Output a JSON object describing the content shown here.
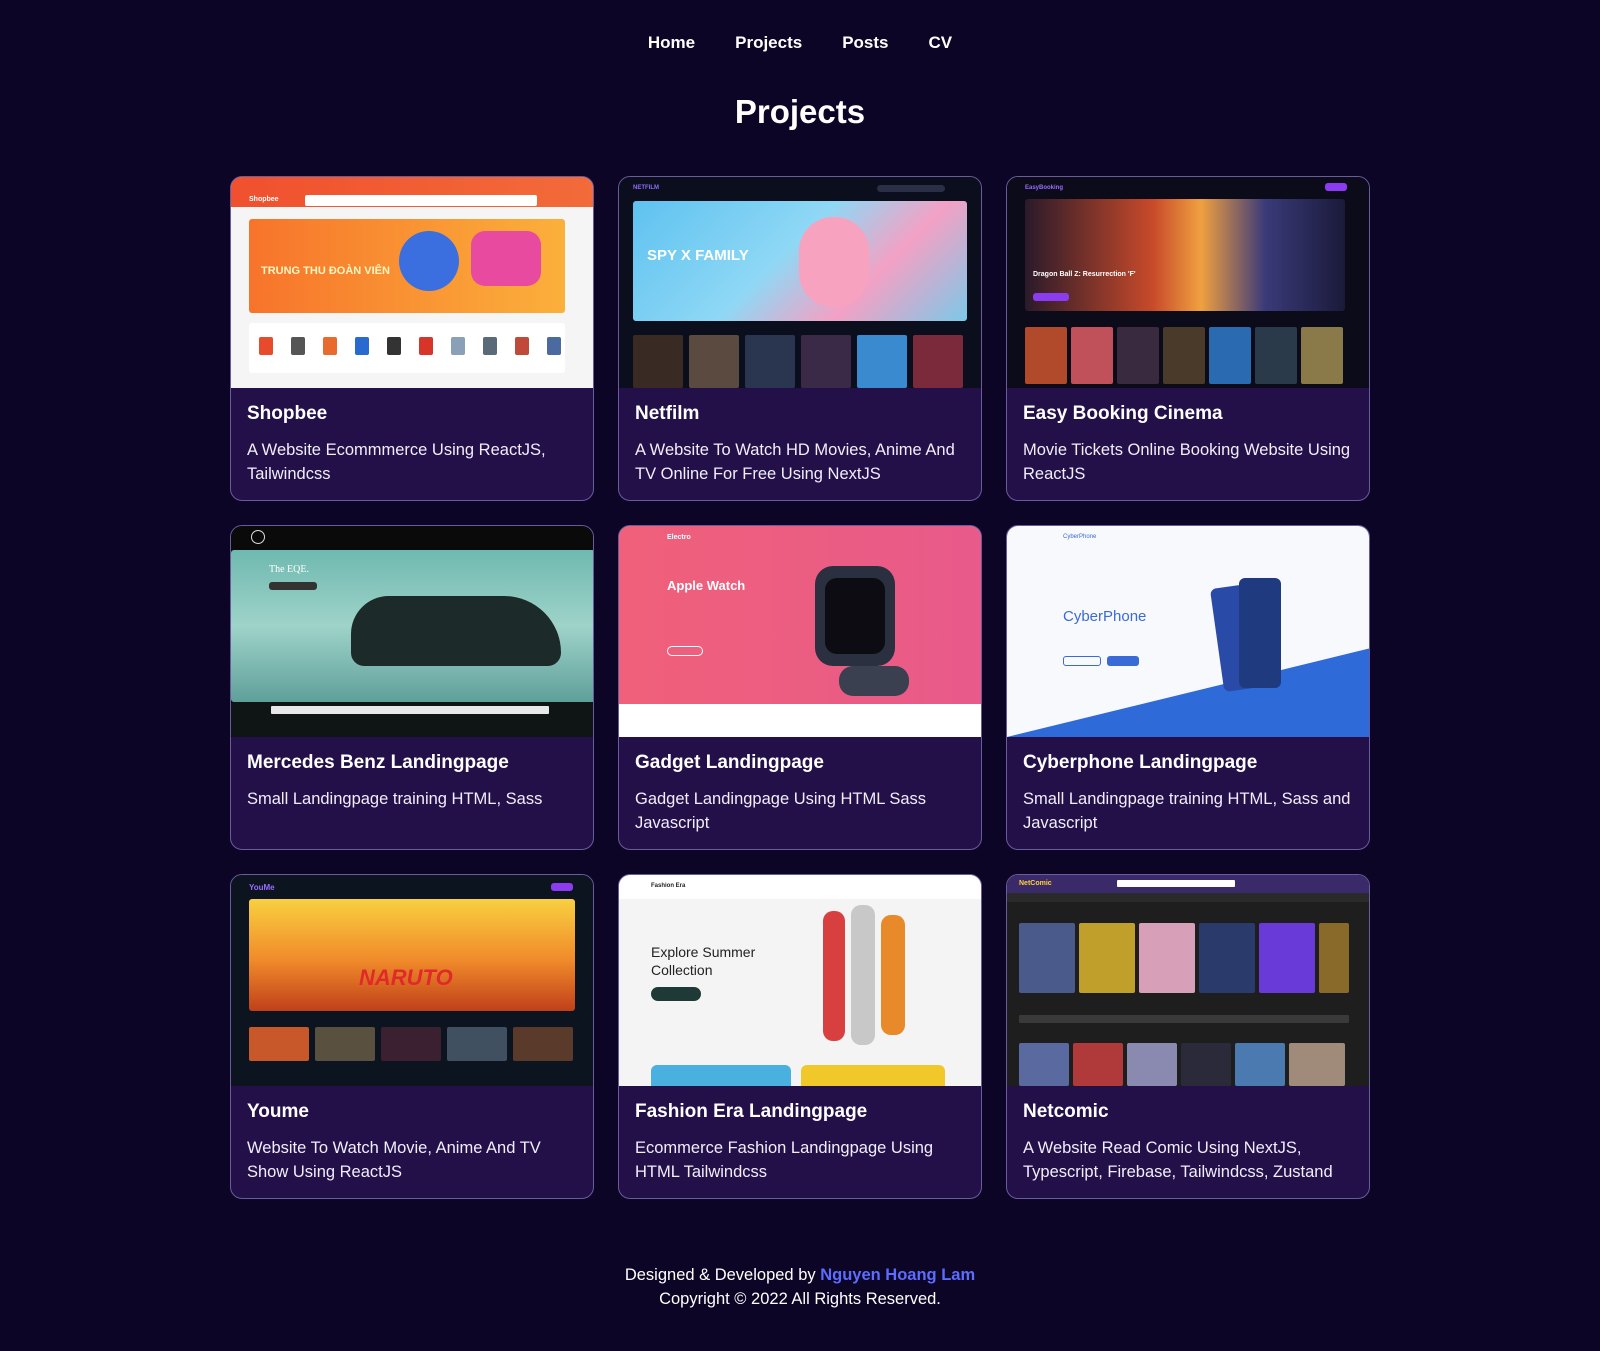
{
  "nav": {
    "items": [
      {
        "label": "Home"
      },
      {
        "label": "Projects"
      },
      {
        "label": "Posts"
      },
      {
        "label": "CV"
      }
    ]
  },
  "page": {
    "title": "Projects"
  },
  "projects": [
    {
      "title": "Shopbee",
      "description": "A Website Ecommmerce Using ReactJS, Tailwindcss",
      "thumb_brand": "Shopbee",
      "thumb_text": "TRUNG THU ĐOÀN VIÊN"
    },
    {
      "title": "Netfilm",
      "description": "A Website To Watch HD Movies, Anime And TV Online For Free Using NextJS",
      "thumb_brand": "NETFILM",
      "thumb_text": "SPY X FAMILY"
    },
    {
      "title": "Easy Booking Cinema",
      "description": "Movie Tickets Online Booking Website Using ReactJS",
      "thumb_brand": "EasyBooking",
      "thumb_text": "Dragon Ball Z: Resurrection 'F'"
    },
    {
      "title": "Mercedes Benz Landingpage",
      "description": "Small Landingpage training HTML, Sass",
      "thumb_brand": "",
      "thumb_text": "The EQE."
    },
    {
      "title": "Gadget Landingpage",
      "description": "Gadget Landingpage Using HTML Sass Javascript",
      "thumb_brand": "Electro",
      "thumb_text": "Apple Watch"
    },
    {
      "title": "Cyberphone Landingpage",
      "description": "Small Landingpage training HTML, Sass and Javascript",
      "thumb_brand": "CyberPhone",
      "thumb_text": "CyberPhone"
    },
    {
      "title": "Youme",
      "description": "Website To Watch Movie, Anime And TV Show Using ReactJS",
      "thumb_brand": "YouMe",
      "thumb_text": "NARUTO"
    },
    {
      "title": "Fashion Era Landingpage",
      "description": "Ecommerce Fashion Landingpage Using HTML Tailwindcss",
      "thumb_brand": "Fashion Era",
      "thumb_text": "Explore Summer Collection"
    },
    {
      "title": "Netcomic",
      "description": "A Website Read Comic Using NextJS, Typescript, Firebase, Tailwindcss, Zustand",
      "thumb_brand": "NetComic",
      "thumb_text": ""
    }
  ],
  "footer": {
    "prefix": "Designed & Developed by",
    "author": "Nguyen Hoang Lam",
    "copyright": "Copyright © 2022 All Rights Reserved."
  },
  "colors": {
    "background": "#0d0526",
    "card": "#231049",
    "card_border": "#6a5a9e",
    "link": "#5b6cff"
  }
}
